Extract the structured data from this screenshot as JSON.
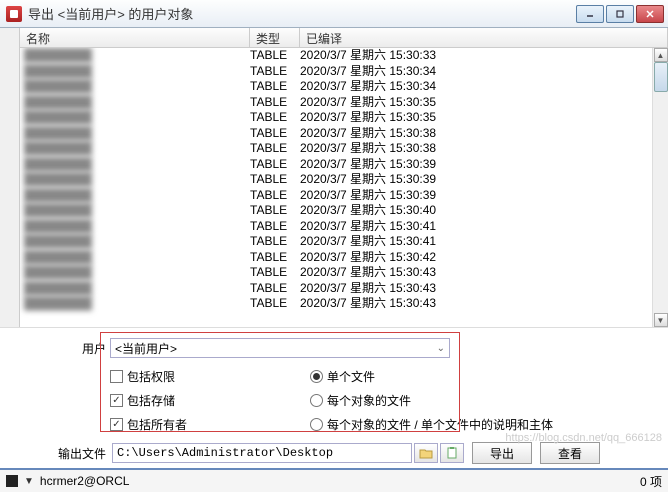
{
  "window": {
    "title": "导出 <当前用户> 的用户对象"
  },
  "table": {
    "headers": {
      "name": "名称",
      "type": "类型",
      "compiled": "已编译"
    },
    "rows": [
      {
        "name": "████████",
        "type": "TABLE",
        "compiled": "2020/3/7 星期六 15:30:33"
      },
      {
        "name": "████████",
        "type": "TABLE",
        "compiled": "2020/3/7 星期六 15:30:34"
      },
      {
        "name": "████████",
        "type": "TABLE",
        "compiled": "2020/3/7 星期六 15:30:34"
      },
      {
        "name": "████████",
        "type": "TABLE",
        "compiled": "2020/3/7 星期六 15:30:35"
      },
      {
        "name": "████████",
        "type": "TABLE",
        "compiled": "2020/3/7 星期六 15:30:35"
      },
      {
        "name": "████████",
        "type": "TABLE",
        "compiled": "2020/3/7 星期六 15:30:38"
      },
      {
        "name": "████████",
        "type": "TABLE",
        "compiled": "2020/3/7 星期六 15:30:38"
      },
      {
        "name": "████████",
        "type": "TABLE",
        "compiled": "2020/3/7 星期六 15:30:39"
      },
      {
        "name": "████████",
        "type": "TABLE",
        "compiled": "2020/3/7 星期六 15:30:39"
      },
      {
        "name": "████████",
        "type": "TABLE",
        "compiled": "2020/3/7 星期六 15:30:39"
      },
      {
        "name": "████████",
        "type": "TABLE",
        "compiled": "2020/3/7 星期六 15:30:40"
      },
      {
        "name": "████████",
        "type": "TABLE",
        "compiled": "2020/3/7 星期六 15:30:41"
      },
      {
        "name": "████████",
        "type": "TABLE",
        "compiled": "2020/3/7 星期六 15:30:41"
      },
      {
        "name": "████████",
        "type": "TABLE",
        "compiled": "2020/3/7 星期六 15:30:42"
      },
      {
        "name": "████████",
        "type": "TABLE",
        "compiled": "2020/3/7 星期六 15:30:43"
      },
      {
        "name": "████████",
        "type": "TABLE",
        "compiled": "2020/3/7 星期六 15:30:43"
      },
      {
        "name": "████████",
        "type": "TABLE",
        "compiled": "2020/3/7 星期六 15:30:43"
      }
    ]
  },
  "form": {
    "user_label": "用户",
    "user_value": "<当前用户>",
    "include_privileges": "包括权限",
    "include_storage": "包括存储",
    "include_owner": "包括所有者",
    "single_file": "单个文件",
    "file_per_object": "每个对象的文件",
    "file_per_object_desc": "每个对象的文件 / 单个文件中的说明和主体"
  },
  "output": {
    "label": "输出文件",
    "value": "C:\\Users\\Administrator\\Desktop"
  },
  "buttons": {
    "export": "导出",
    "view": "查看"
  },
  "status": {
    "connection": "hcrmer2@ORCL",
    "count": "0 项"
  },
  "watermark": "https://blog.csdn.net/qq_666128"
}
